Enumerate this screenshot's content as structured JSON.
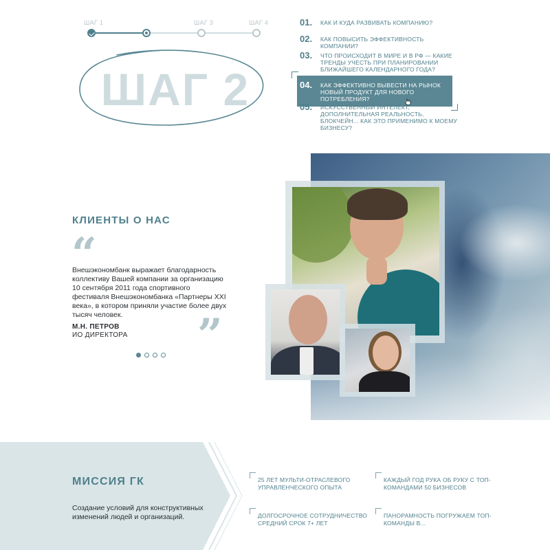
{
  "stepper": {
    "steps": [
      {
        "label": "ШАГ 1",
        "state": "done"
      },
      {
        "label": "",
        "state": "current"
      },
      {
        "label": "ШАГ 3",
        "state": "todo"
      },
      {
        "label": "ШАГ 4",
        "state": "todo"
      }
    ]
  },
  "step_title": "ШАГ 2",
  "questions": [
    {
      "num": "01.",
      "text": "КАК И КУДА РАЗВИВАТЬ КОМПАНИЮ?"
    },
    {
      "num": "02.",
      "text": "КАК ПОВЫСИТЬ ЭФФЕКТИВНОСТЬ КОМПАНИИ?"
    },
    {
      "num": "03.",
      "text": "ЧТО ПРОИСХОДИТ В МИРЕ И В РФ — КАКИЕ ТРЕНДЫ УЧЕСТЬ ПРИ ПЛАНИРОВАНИИ БЛИЖАЙШЕГО КАЛЕНДАРНОГО ГОДА?"
    },
    {
      "num": "04.",
      "text": "КАК ЭФФЕКТИВНО ВЫВЕСТИ НА РЫНОК НОВЫЙ ПРОДУКТ ДЛЯ НОВОГО ПОТРЕБЛЕНИЯ?"
    },
    {
      "num": "05.",
      "text": "ИСКУССТВЕННЫЙ ИНТЕЛЕКТ, ДОПОЛНИТЕЛЬНАЯ РЕАЛЬНОСТЬ, БЛОКЧЕЙН... КАК ЭТО ПРИМЕНИМО К МОЕМУ БИЗНЕСУ?"
    }
  ],
  "active_question": 4,
  "clients": {
    "title": "КЛИЕНТЫ О НАС",
    "quote_open": "“",
    "quote_close": "”",
    "review": "Внешэкономбанк выражает благодарность коллективу Вашей компании за организацию 10 сентября 2011 года спортивного фестиваля Внешэкономбанка «Партнеры XXI века», в котором приняли участие более двух тысяч человек.",
    "author_name": "М.Н. ПЕТРОВ",
    "author_role": "ИО ДИРЕКТОРА",
    "slides_count": 4,
    "active_slide": 1
  },
  "mission": {
    "title": "МИССИЯ ГК",
    "text": "Создание условий для конструктивных изменений людей и организаций.",
    "features": [
      "25 ЛЕТ МУЛЬТИ-ОТРАСЛЕВОГО УПРАВЛЕНЧЕСКОГО ОПЫТА",
      "КАЖДЫЙ ГОД РУКА ОБ РУКУ С ТОП-КОМАНДАМИ 50 БИЗНЕСОВ",
      "ДОЛГОСРОЧНОЕ СОТРУДНИЧЕСТВО СРЕДНИЙ СРОК 7+ ЛЕТ",
      "ПАНОРАМНОСТЬ ПОГРУЖАЕМ ТОП-КОМАНДЫ В..."
    ]
  },
  "colors": {
    "accent": "#4f7f8c",
    "accent_active_bg": "#5a8793",
    "muted": "#cfdcdf",
    "band": "#d9e5e7"
  },
  "icons": [
    "check-icon",
    "cursor-hand-icon",
    "quote-open-icon",
    "quote-close-icon"
  ]
}
